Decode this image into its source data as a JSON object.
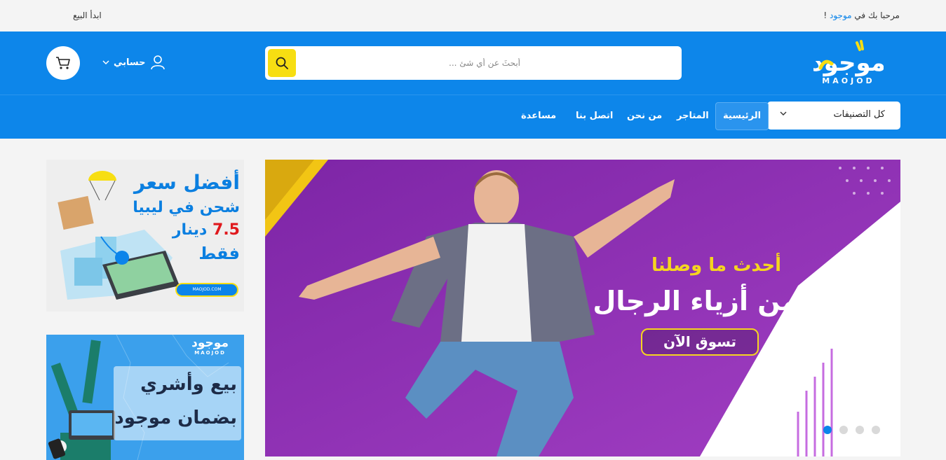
{
  "topbar": {
    "welcome_prefix": "مرحبا بك في",
    "brand": "موجود",
    "welcome_suffix": "!",
    "start_selling": "ابدأ البيع"
  },
  "header": {
    "logo_text": "موجود",
    "logo_latin": "MAOJOD",
    "search_placeholder": "أبحثَ عن أي شئ ...",
    "account_label": "حسابي",
    "icons": [
      "search-icon",
      "user-icon",
      "chevron-down-icon",
      "cart-icon"
    ]
  },
  "nav": {
    "category_select": "كل التصنيفات",
    "items": [
      {
        "label": "الرئيسية",
        "active": true
      },
      {
        "label": "المتاجر",
        "active": false
      },
      {
        "label": "من نحن",
        "active": false
      },
      {
        "label": "اتصل بنا",
        "active": false
      },
      {
        "label": "مساعدة",
        "active": false
      }
    ]
  },
  "hero": {
    "line1": "أحدث ما وصلنا",
    "line2": "من أزياء الرجال",
    "cta": "تسوق الآن",
    "slides": 4,
    "active_slide": 1
  },
  "banner_shipping": {
    "line1": "أفضل سعر",
    "line2": "شحن في ليبيا",
    "price": "7.5",
    "currency": "دينار",
    "line4": "فقط",
    "url": "MAOJOD.COM"
  },
  "banner_sell": {
    "logo_text": "موجود",
    "logo_latin": "MAOJOD",
    "line1": "بيع وأشري",
    "line2": "بضمان موجود"
  },
  "colors": {
    "primary": "#0d86ea",
    "accent": "#f7de12",
    "hero_bg": "#8d2fb0",
    "price_red": "#e0191d"
  }
}
